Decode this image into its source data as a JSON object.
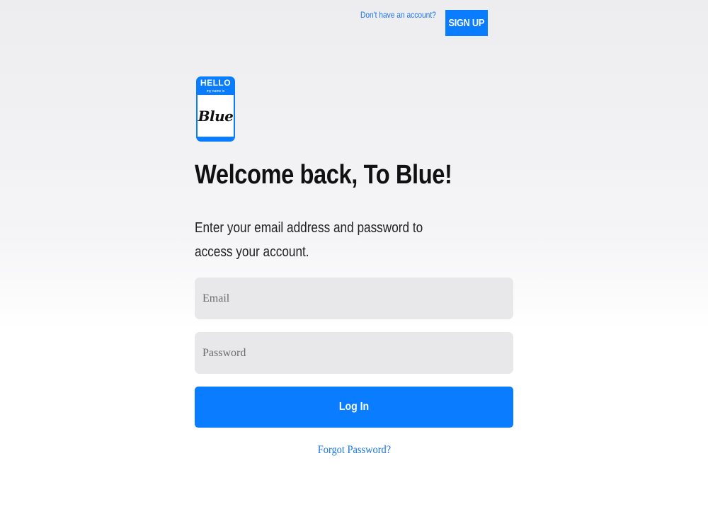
{
  "header": {
    "signup_prompt": "Don't have an account?",
    "signup_label": "SIGN UP"
  },
  "logo": {
    "hello": "HELLO",
    "my_name_is": "my name is",
    "name": "Blue"
  },
  "main": {
    "title": "Welcome back, To Blue!",
    "subtitle": "Enter your email address and password to access your account."
  },
  "form": {
    "email_placeholder": "Email",
    "email_value": "",
    "password_placeholder": "Password",
    "password_value": "",
    "login_label": "Log In",
    "forgot_label": "Forgot Password?"
  },
  "colors": {
    "accent": "#0a7cff",
    "link": "#1a73e8",
    "input_bg": "#e8e8ea"
  }
}
